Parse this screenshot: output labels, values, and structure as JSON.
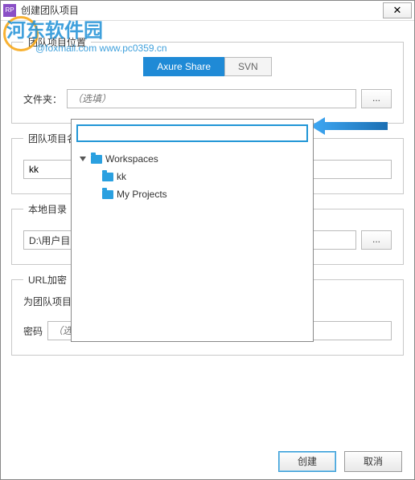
{
  "window": {
    "title": "创建团队项目",
    "close_glyph": "✕"
  },
  "watermark": {
    "text": "河东软件园",
    "sub": "@foxmail.com   www.pc0359.cn"
  },
  "section_location": {
    "legend": "团队项目位置",
    "tabs": {
      "axure": "Axure Share",
      "svn": "SVN"
    },
    "folder_label": "文件夹：",
    "folder_placeholder": "（选填）",
    "browse_label": "..."
  },
  "section_name": {
    "legend": "团队项目名",
    "value": "kk"
  },
  "section_local": {
    "legend": "本地目录",
    "value": "D:\\用户目录",
    "browse_label": "..."
  },
  "section_url": {
    "legend": "URL加密",
    "desc": "为团队项目的HTML链接添加密码保护。",
    "pwd_label": "密码",
    "pwd_placeholder": "（选填）"
  },
  "dropdown": {
    "search_value": "",
    "root": "Workspaces",
    "items": [
      "kk",
      "My Projects"
    ]
  },
  "footer": {
    "create": "创建",
    "cancel": "取消"
  }
}
